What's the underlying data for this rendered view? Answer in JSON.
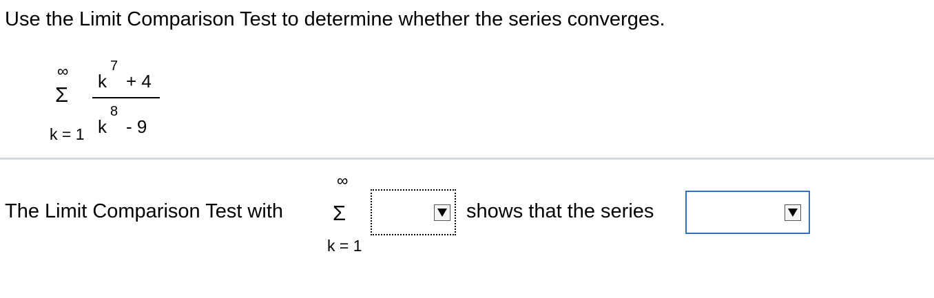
{
  "question": {
    "instruction": "Use the Limit Comparison Test to determine whether the series converges."
  },
  "series": {
    "sum_symbol": "Σ",
    "upper_limit": "∞",
    "lower_limit": "k = 1",
    "numerator": {
      "base": "k",
      "exponent": "7",
      "rest": "+ 4"
    },
    "denominator": {
      "base": "k",
      "exponent": "8",
      "rest": "- 9"
    }
  },
  "answer": {
    "lead_text": "The Limit Comparison Test with",
    "sum_symbol": "Σ",
    "upper_limit": "∞",
    "lower_limit": "k = 1",
    "comparison_dropdown": {
      "value": ""
    },
    "middle_text": "shows that the series",
    "conclusion_dropdown": {
      "value": ""
    }
  },
  "colors": {
    "divider": "#d2d8e2",
    "active_dropdown_border": "#2f6fc7"
  }
}
